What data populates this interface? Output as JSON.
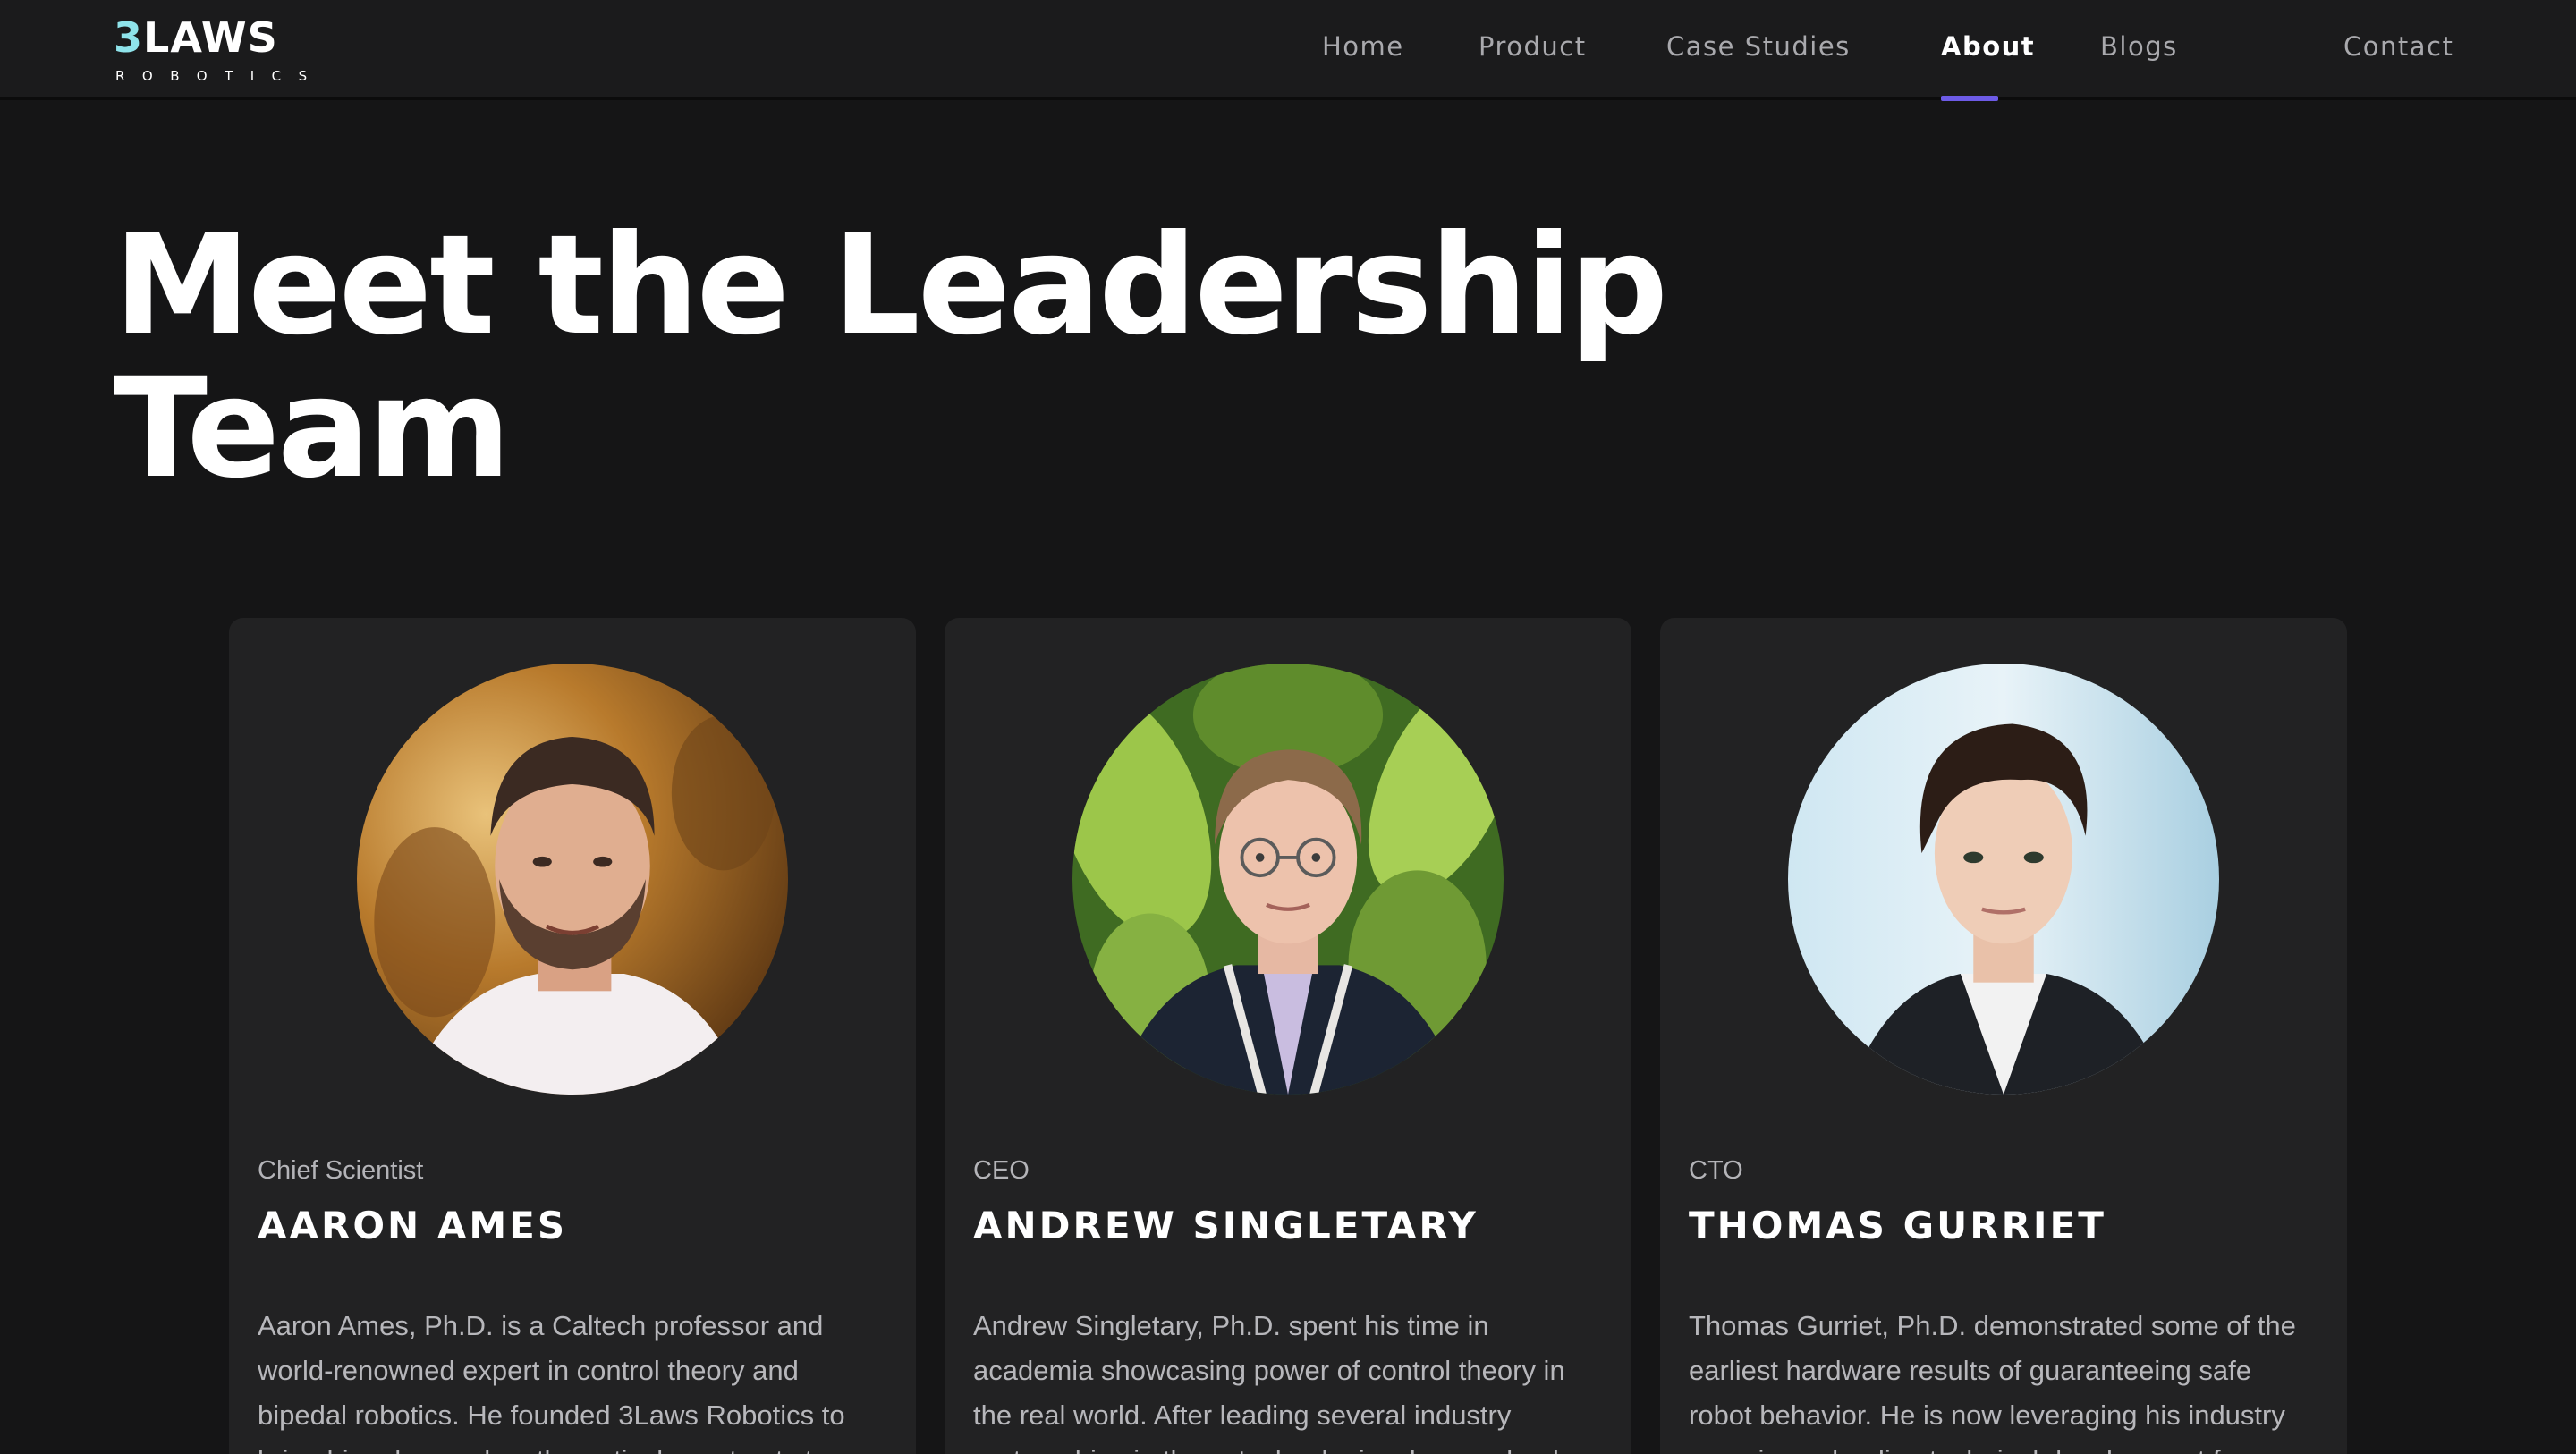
{
  "brand": {
    "logo_main_digit": "3",
    "logo_main_rest": "LAWS",
    "logo_sub": "ROBOTICS"
  },
  "nav": {
    "items": [
      {
        "label": "Home"
      },
      {
        "label": "Product"
      },
      {
        "label": "Case Studies"
      },
      {
        "label": "About"
      },
      {
        "label": "Blogs"
      },
      {
        "label": "Contact"
      }
    ],
    "active": "About"
  },
  "page": {
    "title_line1": "Meet the Leadership",
    "title_line2": "Team"
  },
  "team": [
    {
      "role": "Chief Scientist",
      "name": "AARON AMES",
      "bio": "Aaron Ames, Ph.D. is a Caltech professor and world-renowned expert in control theory and bipedal robotics. He founded 3Laws Robotics to bring his advanced mathematical constructs to"
    },
    {
      "role": "CEO",
      "name": "ANDREW SINGLETARY",
      "bio": "Andrew Singletary, Ph.D. spent his time in academia showcasing power of control theory in the real world. After leading several industry partnerships in these technologies, he now leads"
    },
    {
      "role": "CTO",
      "name": "THOMAS GURRIET",
      "bio": "Thomas Gurriet, Ph.D. demonstrated some of the earliest hardware results of guaranteeing safe robot behavior. He is now leveraging his industry experience leading technical development for"
    }
  ],
  "colors": {
    "background": "#151516",
    "navbar": "#1b1b1c",
    "card": "#222223",
    "accent": "#6d5be6",
    "logo_digit": "#8fe3ea"
  }
}
